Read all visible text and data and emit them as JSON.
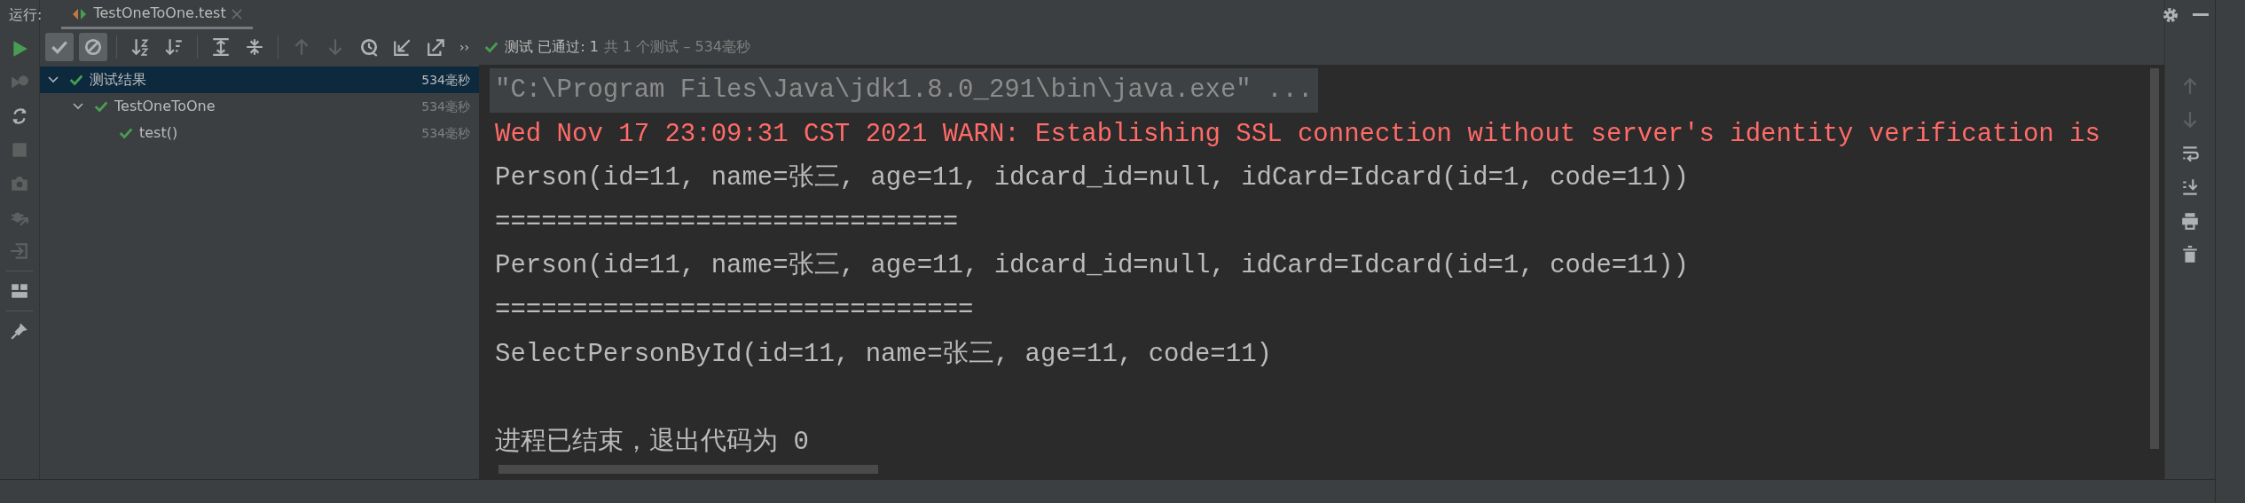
{
  "run_panel": {
    "label": "运行:",
    "tab": {
      "title": "TestOneToOne.test",
      "selected": true
    }
  },
  "left_tools": [
    {
      "kind": "run",
      "disabled": false
    },
    {
      "kind": "rerun-failed",
      "disabled": true
    },
    {
      "kind": "toggle-auto",
      "disabled": false
    },
    {
      "kind": "stop",
      "disabled": true
    },
    {
      "kind": "camera",
      "disabled": true
    },
    {
      "kind": "bug-exit",
      "disabled": true
    },
    {
      "kind": "enter",
      "disabled": true
    },
    {
      "kind": "separator"
    },
    {
      "kind": "layout",
      "disabled": false
    },
    {
      "kind": "separator"
    },
    {
      "kind": "pin",
      "disabled": false
    }
  ],
  "toolbar": [
    {
      "kind": "check",
      "selected": true,
      "disabled": false
    },
    {
      "kind": "cancel",
      "selected": true,
      "disabled": false
    },
    {
      "kind": "separator"
    },
    {
      "kind": "sort-alpha",
      "selected": false,
      "disabled": false
    },
    {
      "kind": "sort-duration",
      "selected": false,
      "disabled": false
    },
    {
      "kind": "separator"
    },
    {
      "kind": "expand",
      "selected": false,
      "disabled": false
    },
    {
      "kind": "collapse",
      "selected": false,
      "disabled": false
    },
    {
      "kind": "separator"
    },
    {
      "kind": "up",
      "selected": false,
      "disabled": true
    },
    {
      "kind": "down",
      "selected": false,
      "disabled": true
    },
    {
      "kind": "history",
      "selected": false,
      "disabled": false
    },
    {
      "kind": "import",
      "selected": false,
      "disabled": false
    },
    {
      "kind": "export",
      "selected": false,
      "disabled": false
    },
    {
      "kind": "more",
      "text": "››"
    }
  ],
  "status": {
    "passed": true,
    "result": "测试 已通过: 1",
    "summary": "共 1 个测试 – 534毫秒"
  },
  "tree": [
    {
      "label": "测试结果",
      "time": "534毫秒",
      "passed": true,
      "expanded": true,
      "selected": true,
      "children": [
        {
          "label": "TestOneToOne",
          "time": "534毫秒",
          "passed": true,
          "expanded": true,
          "selected": false,
          "children": [
            {
              "label": "test()",
              "time": "534毫秒",
              "passed": true,
              "selected": false
            }
          ]
        }
      ]
    }
  ],
  "console": [
    {
      "kind": "command",
      "text": "\"C:\\Program Files\\Java\\jdk1.8.0_291\\bin\\java.exe\" ..."
    },
    {
      "kind": "error",
      "text": "Wed Nov 17 23:09:31 CST 2021 WARN: Establishing SSL connection without server's identity verification is"
    },
    {
      "kind": "output",
      "text": "Person(id=11, name=张三, age=11, idcard_id=null, idCard=Idcard(id=1, code=11))"
    },
    {
      "kind": "output",
      "text": "=============================="
    },
    {
      "kind": "output",
      "text": "Person(id=11, name=张三, age=11, idcard_id=null, idCard=Idcard(id=1, code=11))"
    },
    {
      "kind": "output",
      "text": "==============================="
    },
    {
      "kind": "output",
      "text": "SelectPersonById(id=11, name=张三, age=11, code=11)"
    },
    {
      "kind": "blank"
    },
    {
      "kind": "output",
      "text": "进程已结束，退出代码为 0"
    }
  ],
  "right_tools": [
    {
      "kind": "up",
      "disabled": true
    },
    {
      "kind": "down",
      "disabled": true
    },
    {
      "kind": "wrap",
      "disabled": false
    },
    {
      "kind": "scroll-end",
      "disabled": false
    },
    {
      "kind": "print",
      "disabled": false
    },
    {
      "kind": "trash",
      "disabled": false
    }
  ]
}
